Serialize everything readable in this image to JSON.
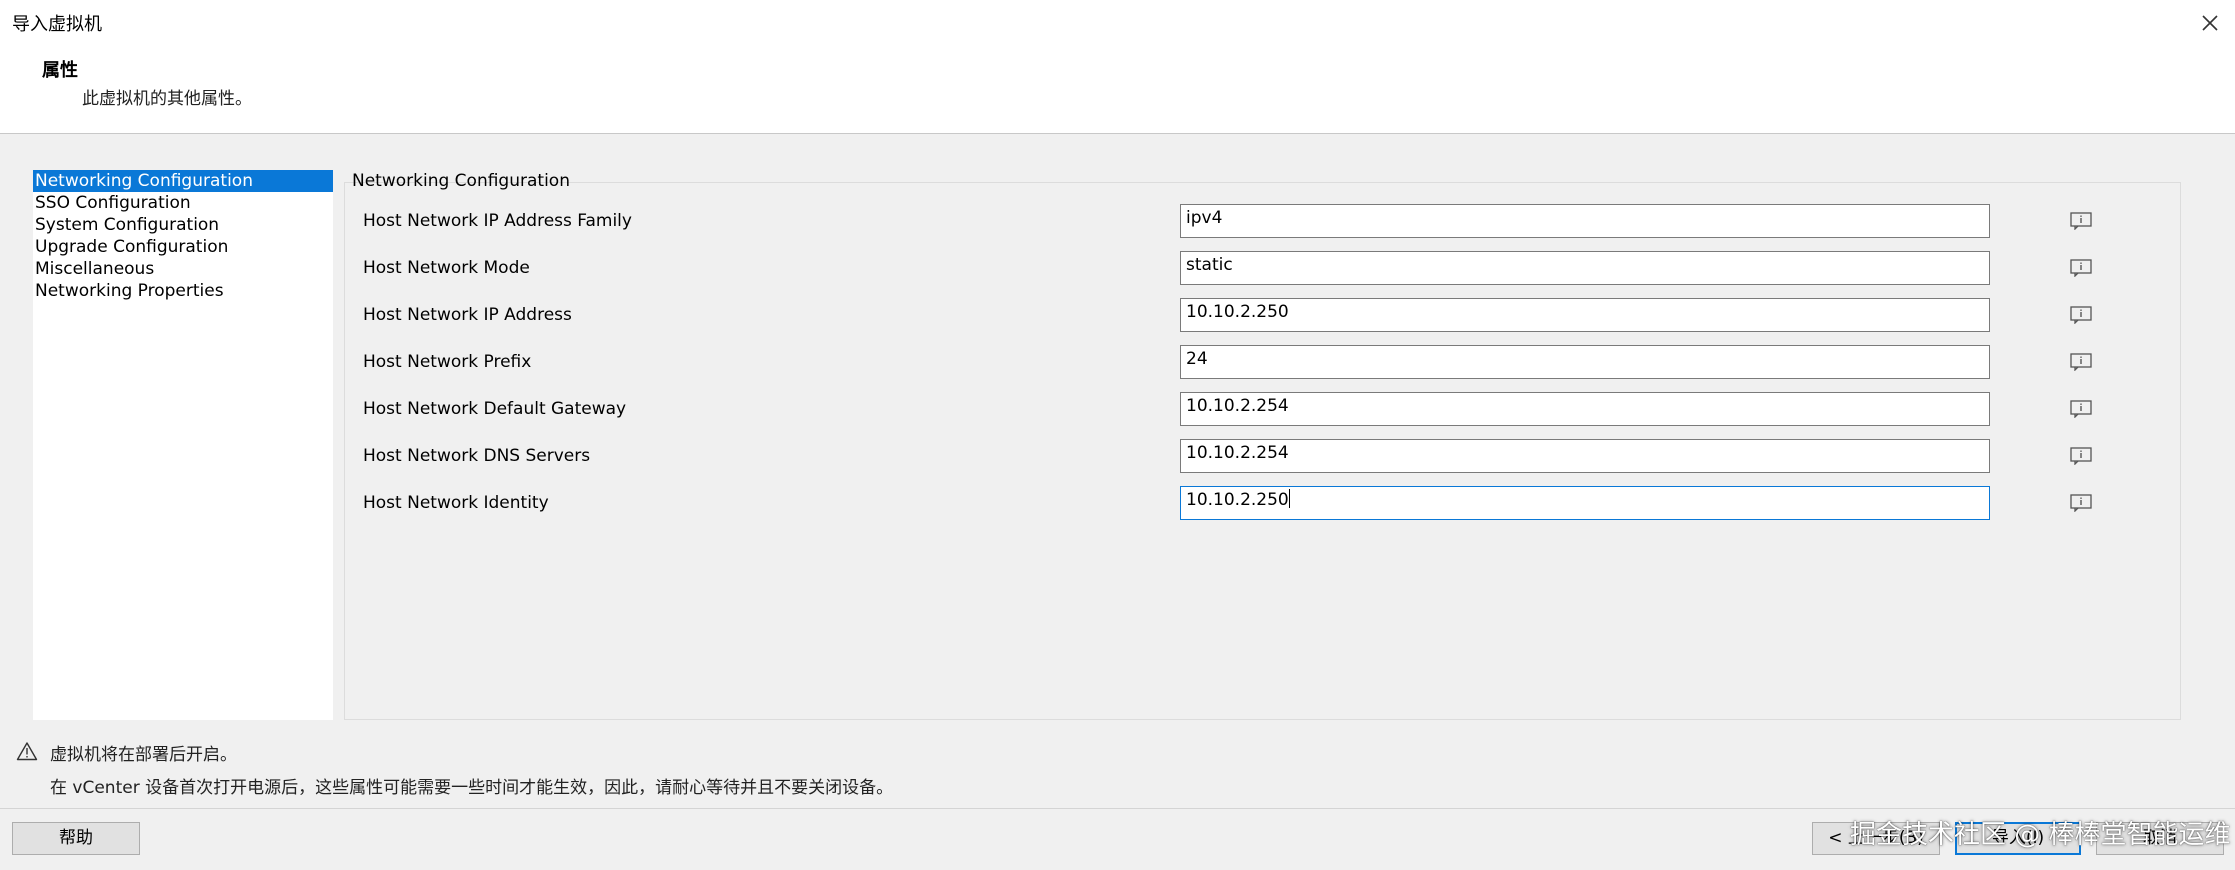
{
  "window": {
    "title": "导入虚拟机"
  },
  "header": {
    "heading": "属性",
    "subtitle": "此虚拟机的其他属性。"
  },
  "nav": {
    "items": [
      {
        "label": "Networking Configuration",
        "selected": true
      },
      {
        "label": "SSO Configuration"
      },
      {
        "label": "System Configuration"
      },
      {
        "label": "Upgrade Configuration"
      },
      {
        "label": "Miscellaneous"
      },
      {
        "label": "Networking Properties"
      }
    ]
  },
  "group": {
    "title": "Networking Configuration",
    "rows": [
      {
        "label": "Host Network IP Address Family",
        "value": "ipv4"
      },
      {
        "label": "Host Network Mode",
        "value": "static"
      },
      {
        "label": "Host Network IP Address",
        "value": "10.10.2.250"
      },
      {
        "label": "Host Network Prefix",
        "value": "24"
      },
      {
        "label": "Host Network Default Gateway",
        "value": "10.10.2.254"
      },
      {
        "label": "Host Network DNS Servers",
        "value": "10.10.2.254"
      },
      {
        "label": "Host Network Identity",
        "value": "10.10.2.250",
        "focused": true
      }
    ]
  },
  "notes": {
    "line1": "虚拟机将在部署后开启。",
    "line2": "在 vCenter 设备首次打开电源后，这些属性可能需要一些时间才能生效，因此，请耐心等待并且不要关闭设备。"
  },
  "buttons": {
    "help": "帮助",
    "back": "< 上一步(B)",
    "finish": "导入(I)",
    "cancel": "取消"
  },
  "watermark": "掘金技术社区 @ 棒棒堂智能运维",
  "colors": {
    "accent": "#0a78d7"
  }
}
